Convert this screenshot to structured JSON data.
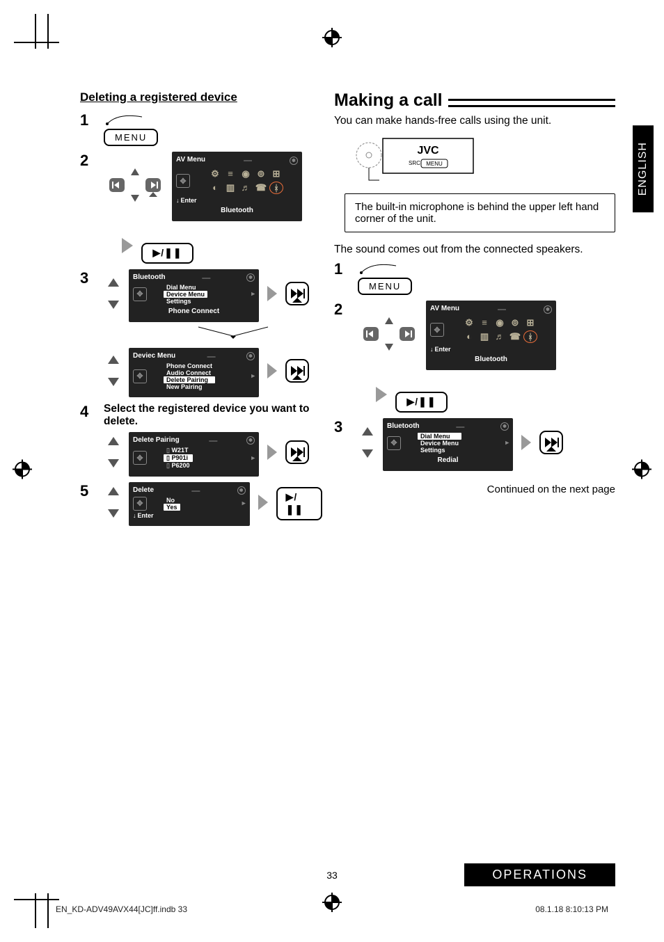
{
  "language_tab": "ENGLISH",
  "page_number": "33",
  "operations_label": "OPERATIONS",
  "imprint_left": "EN_KD-ADV49AVX44[JC]ff.indb   33",
  "imprint_right": "08.1.18   8:10:13 PM",
  "left": {
    "heading": "Deleting a registered device",
    "step1_num": "1",
    "menu_label": "MENU",
    "step2_num": "2",
    "av_menu": {
      "title": "AV Menu",
      "enter": "Enter",
      "caption": "Bluetooth"
    },
    "step3_num": "3",
    "bt_menu": {
      "title": "Bluetooth",
      "items": [
        "Dial Menu",
        "Device Menu",
        "Settings"
      ],
      "highlight": "Device Menu",
      "caption": "Phone Connect"
    },
    "dev_menu": {
      "title": "Deviec Menu",
      "items": [
        "Phone Connect",
        "Audio Connect",
        "Delete Pairing",
        "New Pairing"
      ],
      "highlight": "Delete Pairing"
    },
    "step4_num": "4",
    "step4_text": "Select the registered device you want to delete.",
    "del_pair": {
      "title": "Delete Pairing",
      "items": [
        "W21T",
        "P901i",
        "P6200"
      ],
      "highlight": "P901i"
    },
    "step5_num": "5",
    "delete_menu": {
      "title": "Delete",
      "items": [
        "No",
        "Yes"
      ],
      "highlight": "Yes",
      "enter": "Enter"
    }
  },
  "right": {
    "heading": "Making a call",
    "intro": "You can make hands-free calls using the unit.",
    "jvc_brand": "JVC",
    "jvc_src": "SRC",
    "jvc_menu": "MENU",
    "callout": "The built-in microphone is behind the upper left hand corner of the unit.",
    "sound_text": "The sound comes out from the connected speakers.",
    "step1_num": "1",
    "menu_label": "MENU",
    "step2_num": "2",
    "av_menu": {
      "title": "AV Menu",
      "enter": "Enter",
      "caption": "Bluetooth"
    },
    "step3_num": "3",
    "bt_menu": {
      "title": "Bluetooth",
      "items": [
        "Dial Menu",
        "Device Menu",
        "Settings"
      ],
      "highlight": "Dial Menu",
      "caption": "Redial"
    },
    "continued": "Continued on the next page"
  }
}
